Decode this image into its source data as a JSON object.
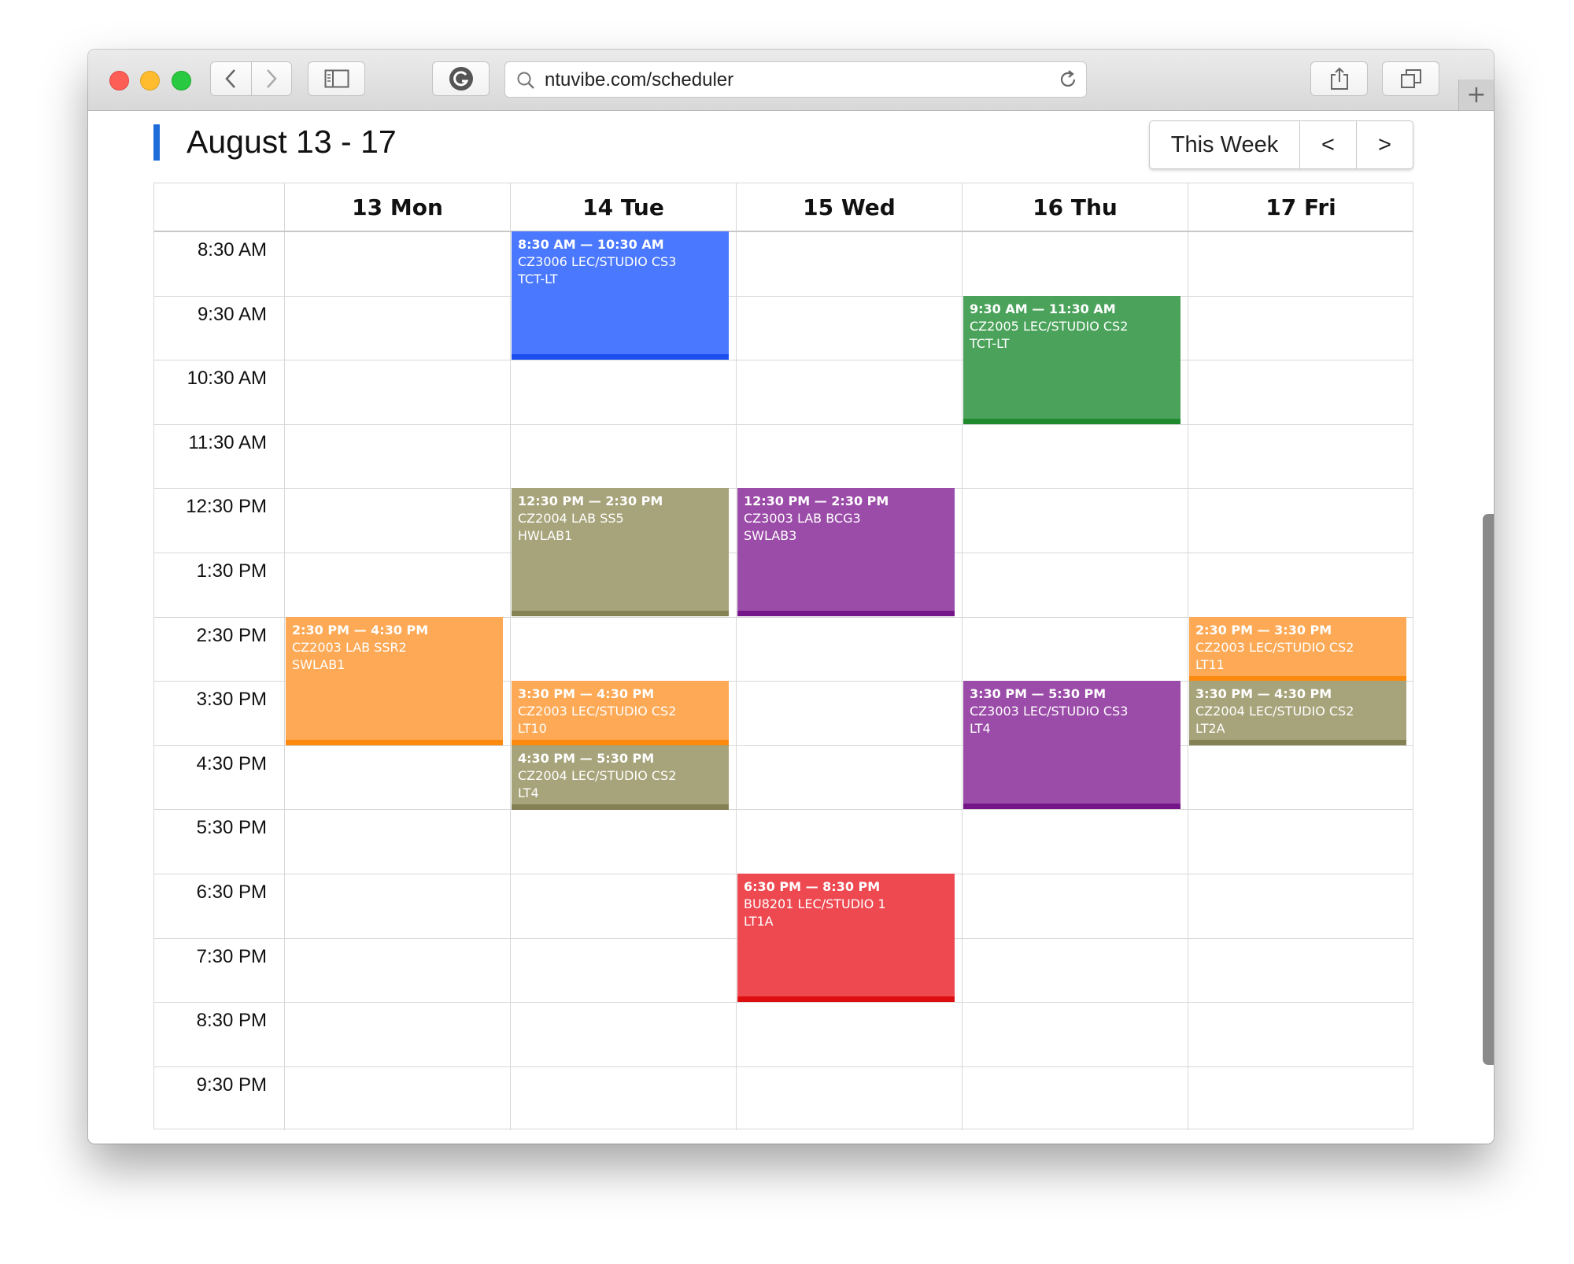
{
  "browser": {
    "url": "ntuvibe.com/scheduler"
  },
  "page": {
    "title": "August 13 - 17",
    "this_week_label": "This Week",
    "prev_label": "<",
    "next_label": ">"
  },
  "days": [
    "13 Mon",
    "14 Tue",
    "15 Wed",
    "16 Thu",
    "17 Fri"
  ],
  "times": [
    "8:30 AM",
    "9:30 AM",
    "10:30 AM",
    "11:30 AM",
    "12:30 PM",
    "1:30 PM",
    "2:30 PM",
    "3:30 PM",
    "4:30 PM",
    "5:30 PM",
    "6:30 PM",
    "7:30 PM",
    "8:30 PM",
    "9:30 PM"
  ],
  "events": [
    {
      "day": 1,
      "start": 0,
      "end": 2,
      "time": "8:30 AM — 10:30 AM",
      "title": "CZ3006 LEC/STUDIO CS3",
      "location": "TCT-LT",
      "color": "#4a78fe",
      "bar": "#1c4ff0"
    },
    {
      "day": 3,
      "start": 1,
      "end": 3,
      "time": "9:30 AM — 11:30 AM",
      "title": "CZ2005 LEC/STUDIO CS2",
      "location": "TCT-LT",
      "color": "#4ba35b",
      "bar": "#1f8a2d"
    },
    {
      "day": 1,
      "start": 4,
      "end": 6,
      "time": "12:30 PM — 2:30 PM",
      "title": "CZ2004 LAB SS5",
      "location": "HWLAB1",
      "color": "#a7a37a",
      "bar": "#858155"
    },
    {
      "day": 2,
      "start": 4,
      "end": 6,
      "time": "12:30 PM — 2:30 PM",
      "title": "CZ3003 LAB BCG3",
      "location": "SWLAB3",
      "color": "#9b4ba8",
      "bar": "#74158a"
    },
    {
      "day": 0,
      "start": 6,
      "end": 8,
      "time": "2:30 PM — 4:30 PM",
      "title": "CZ2003 LAB SSR2",
      "location": "SWLAB1",
      "color": "#fda955",
      "bar": "#fb8a0f"
    },
    {
      "day": 4,
      "start": 6,
      "end": 7,
      "time": "2:30 PM — 3:30 PM",
      "title": "CZ2003 LEC/STUDIO CS2",
      "location": "LT11",
      "color": "#fda955",
      "bar": "#fb8a0f"
    },
    {
      "day": 1,
      "start": 7,
      "end": 8,
      "time": "3:30 PM — 4:30 PM",
      "title": "CZ2003 LEC/STUDIO CS2",
      "location": "LT10",
      "color": "#fda955",
      "bar": "#fb8a0f"
    },
    {
      "day": 3,
      "start": 7,
      "end": 9,
      "time": "3:30 PM — 5:30 PM",
      "title": "CZ3003 LEC/STUDIO CS3",
      "location": "LT4",
      "color": "#9b4ba8",
      "bar": "#74158a"
    },
    {
      "day": 4,
      "start": 7,
      "end": 8,
      "time": "3:30 PM — 4:30 PM",
      "title": "CZ2004 LEC/STUDIO CS2",
      "location": "LT2A",
      "color": "#a7a37a",
      "bar": "#858155"
    },
    {
      "day": 1,
      "start": 8,
      "end": 9,
      "time": "4:30 PM — 5:30 PM",
      "title": "CZ2004 LEC/STUDIO CS2",
      "location": "LT4",
      "color": "#a7a37a",
      "bar": "#858155"
    },
    {
      "day": 2,
      "start": 10,
      "end": 12,
      "time": "6:30 PM — 8:30 PM",
      "title": "BU8201 LEC/STUDIO 1",
      "location": "LT1A",
      "color": "#ee4951",
      "bar": "#de0e10"
    }
  ]
}
